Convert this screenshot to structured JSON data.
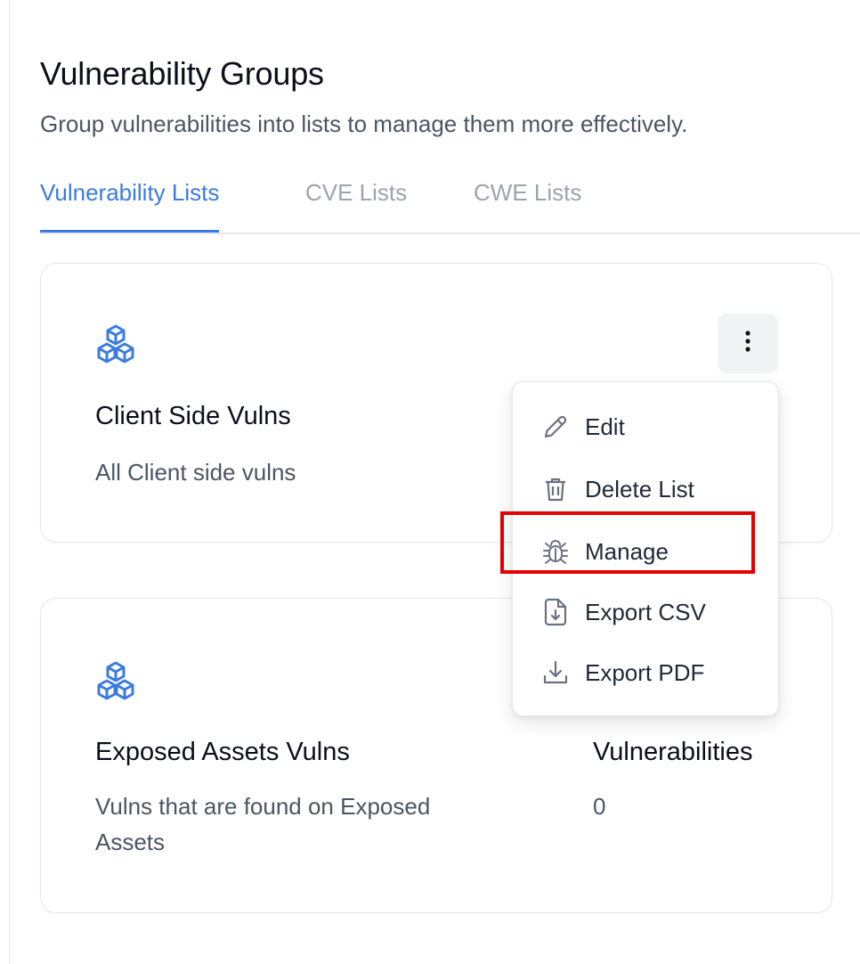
{
  "header": {
    "title": "Vulnerability Groups",
    "subtitle": "Group vulnerabilities into lists to manage them more effectively."
  },
  "tabs": [
    {
      "label": "Vulnerability Lists",
      "active": true
    },
    {
      "label": "CVE Lists",
      "active": false
    },
    {
      "label": "CWE Lists",
      "active": false
    }
  ],
  "cards": [
    {
      "icon": "cubes-icon",
      "title": "Client Side Vulns",
      "description": "All Client side vulns"
    },
    {
      "icon": "cubes-icon",
      "title": "Exposed Assets Vulns",
      "description": "Vulns that are found on Exposed Assets",
      "stat_label": "Vulnerabilities",
      "stat_value": "0"
    }
  ],
  "menu": {
    "items": [
      {
        "label": "Edit",
        "icon": "pencil-icon"
      },
      {
        "label": "Delete List",
        "icon": "trash-icon"
      },
      {
        "label": "Manage",
        "icon": "bug-icon",
        "highlighted": true
      },
      {
        "label": "Export CSV",
        "icon": "file-download-icon"
      },
      {
        "label": "Export PDF",
        "icon": "download-icon"
      }
    ]
  },
  "colors": {
    "accent": "#3b7be0",
    "highlight": "#e60000",
    "muted_text": "#4b5563",
    "tab_inactive": "#9ca3af"
  }
}
